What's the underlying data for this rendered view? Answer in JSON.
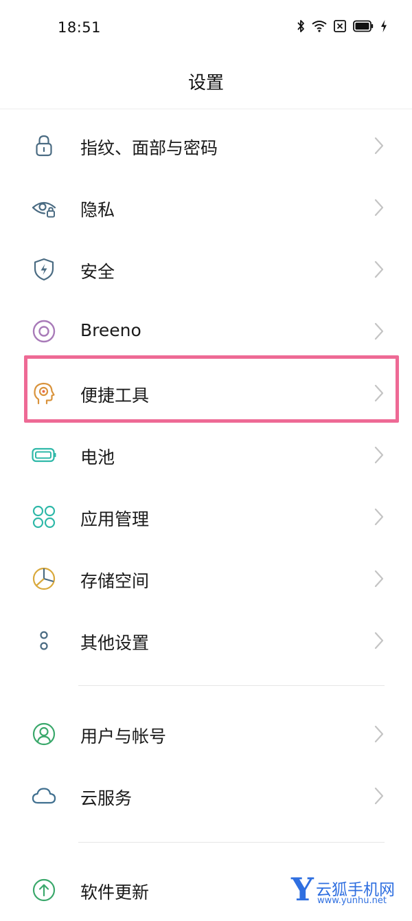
{
  "status_bar": {
    "time": "18:51",
    "icons": [
      "bluetooth-icon",
      "wifi-icon",
      "sim-off-icon",
      "battery-icon",
      "charging-icon"
    ]
  },
  "header": {
    "title": "设置"
  },
  "settings": {
    "items": [
      {
        "label": "指纹、面部与密码",
        "icon": "lock-icon",
        "color": "#4a6b82"
      },
      {
        "label": "隐私",
        "icon": "privacy-eye-icon",
        "color": "#4a6b82"
      },
      {
        "label": "安全",
        "icon": "shield-icon",
        "color": "#4a6b82"
      },
      {
        "label": "Breeno",
        "icon": "breeno-icon",
        "color": "#a87ab8"
      },
      {
        "label": "便捷工具",
        "icon": "convenience-tools-icon",
        "color": "#d9933c"
      },
      {
        "label": "电池",
        "icon": "battery-icon",
        "color": "#2eb8a8"
      },
      {
        "label": "应用管理",
        "icon": "apps-icon",
        "color": "#2eb8a8"
      },
      {
        "label": "存储空间",
        "icon": "storage-icon",
        "color": "#d9a93c"
      },
      {
        "label": "其他设置",
        "icon": "more-settings-icon",
        "color": "#4a6b82"
      },
      {
        "label": "用户与帐号",
        "icon": "user-icon",
        "color": "#3aa86b"
      },
      {
        "label": "云服务",
        "icon": "cloud-icon",
        "color": "#3f6f8f"
      },
      {
        "label": "软件更新",
        "icon": "update-icon",
        "color": "#3aa86b"
      }
    ]
  },
  "annotation": {
    "highlight_color": "#ee6a95"
  },
  "watermark": {
    "logo": "Y",
    "text": "云狐手机网",
    "url": "www.yunhu.net"
  }
}
